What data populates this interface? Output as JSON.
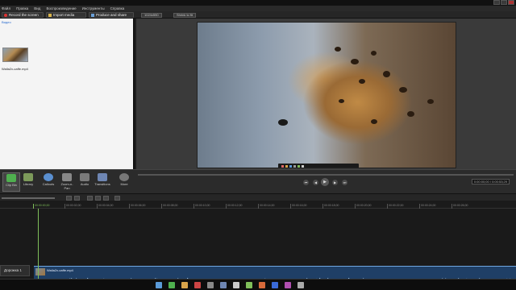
{
  "menu": [
    "Файл",
    "Правка",
    "Вид",
    "Воспроизведение",
    "Инструменты",
    "Справка"
  ],
  "toolbar": {
    "record": "Record the screen",
    "import": "Import media",
    "produce": "Produce and share",
    "zoom": "1024x590",
    "shrink": "Shrink to fit"
  },
  "clipbin": {
    "header": "Видео",
    "clip_name": "Walla2x-caffe.mp4"
  },
  "tabs": [
    {
      "label": "Clip Bin",
      "color": "#4fb04f"
    },
    {
      "label": "Library",
      "color": "#7c9a5a"
    },
    {
      "label": "Callouts",
      "color": "#5a8fd0"
    },
    {
      "label": "Zoom-n-Pan",
      "color": "#888"
    },
    {
      "label": "Audio",
      "color": "#7a7a7a"
    },
    {
      "label": "Transitions",
      "color": "#6e86b3"
    },
    {
      "label": "More",
      "color": "#777"
    }
  ],
  "player": {
    "timecode": "0:00:00;00 / 0:00:53;29"
  },
  "ruler_ticks": [
    "00:00:00;00",
    "00:00:02;00",
    "00:00:04;00",
    "00:00:06;00",
    "00:00:08;00",
    "00:00:10;00",
    "00:00:12;00",
    "00:00:14;00",
    "00:00:16;00",
    "00:00:18;00",
    "00:00:20;00",
    "00:00:22;00",
    "00:00:24;00",
    "00:00:26;00"
  ],
  "track": {
    "label": "Дорожка 1",
    "clip_name": "Walla2x-caffe.mp4"
  },
  "colors": {
    "accent_green": "#7fbf5a",
    "clip_blue": "#1f3f66",
    "waveform": "#9cc6f0"
  }
}
